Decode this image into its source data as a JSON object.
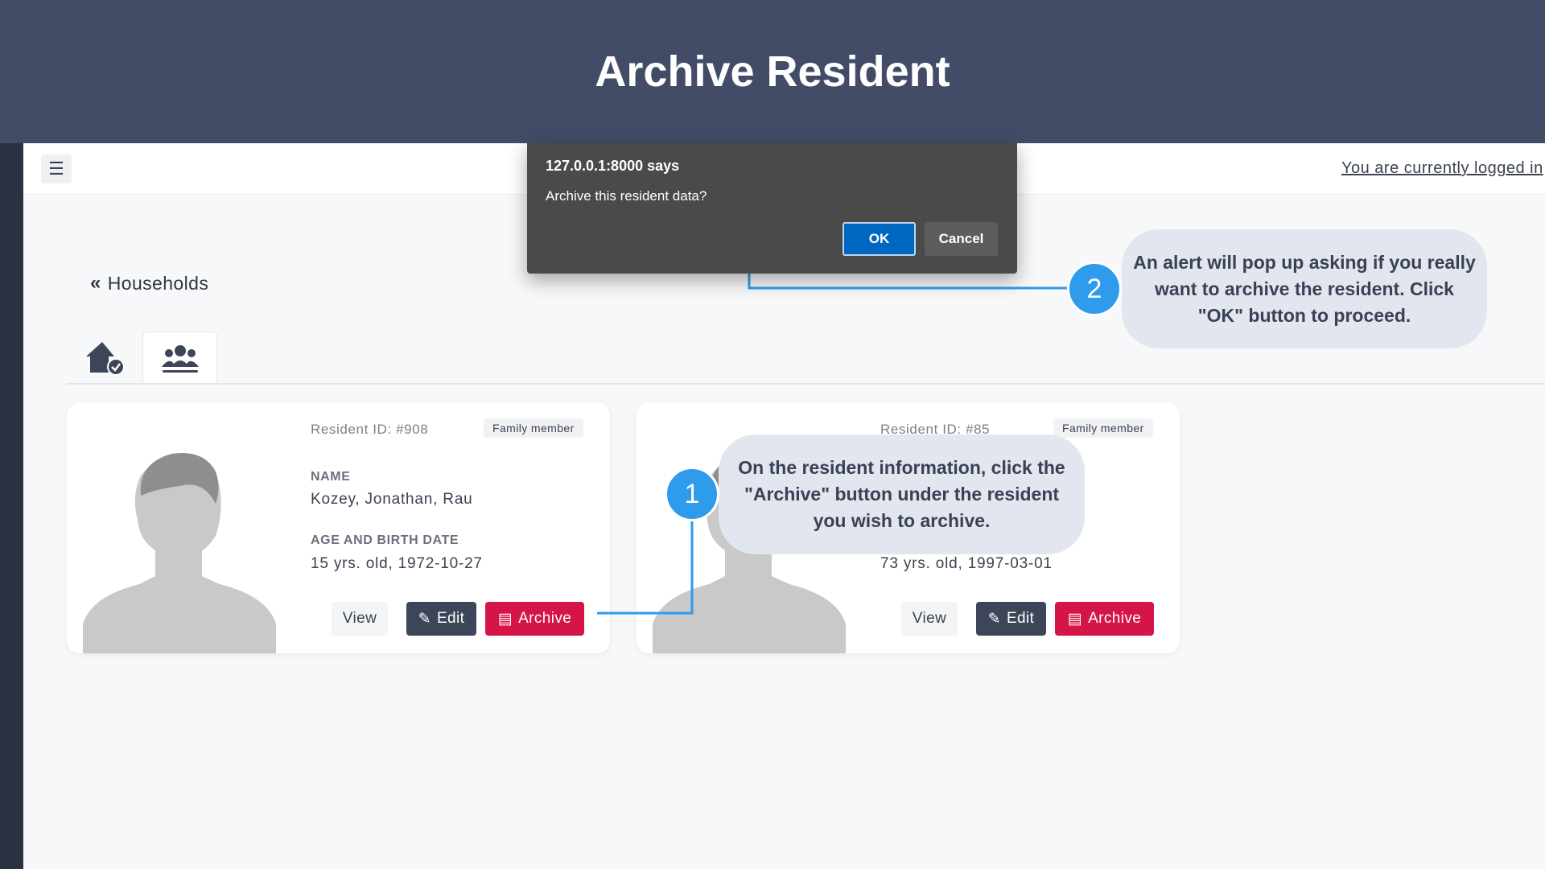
{
  "banner": {
    "title": "Archive Resident"
  },
  "topbar": {
    "menu_icon": "hamburger-menu-icon",
    "logged_in_text": "You are currently logged in"
  },
  "nav": {
    "back_label": "Households",
    "back_icon": "double-chevron-left-icon"
  },
  "tabs": [
    {
      "icon": "house-check-icon",
      "active": false
    },
    {
      "icon": "users-group-icon",
      "active": true
    }
  ],
  "residents": [
    {
      "id_label": "Resident ID: #908",
      "badge": "Family member",
      "name_label": "NAME",
      "name": "Kozey, Jonathan, Rau",
      "age_label": "AGE AND BIRTH DATE",
      "age": "15 yrs. old, 1972-10-27",
      "view_label": "View",
      "edit_label": "Edit",
      "archive_label": "Archive"
    },
    {
      "id_label": "Resident ID: #85",
      "badge": "Family member",
      "age": "73 yrs. old, 1997-03-01",
      "view_label": "View",
      "edit_label": "Edit",
      "archive_label": "Archive"
    }
  ],
  "dialog": {
    "title": "127.0.0.1:8000 says",
    "message": "Archive this resident data?",
    "ok_label": "OK",
    "cancel_label": "Cancel"
  },
  "steps": [
    {
      "number": "1",
      "text": "On the resident information, click the \"Archive\" button under the resident you wish to archive."
    },
    {
      "number": "2",
      "text": "An alert will pop up asking if you really want to archive the resident. Click \"OK\" button to proceed."
    }
  ],
  "colors": {
    "banner": "#424c66",
    "archive_button": "#d51447",
    "edit_button": "#3d4659",
    "step_circle": "#2f9bec",
    "connector_line": "#2f9bec",
    "dialog_ok": "#0067c0"
  }
}
